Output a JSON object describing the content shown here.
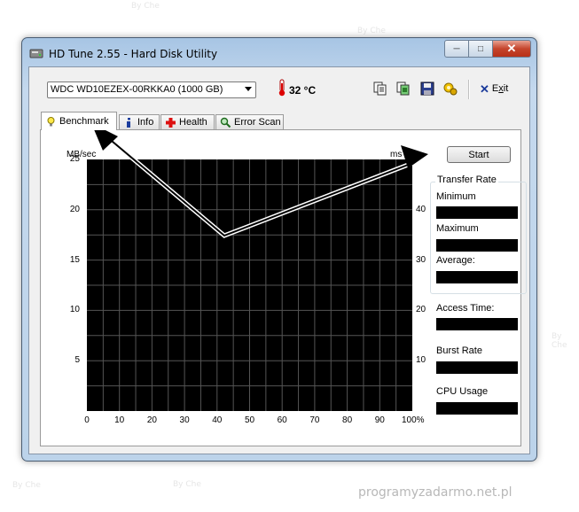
{
  "window": {
    "title": "HD Tune 2.55 - Hard Disk Utility",
    "caption": {
      "minimize": "─",
      "maximize": "□",
      "close": "✕"
    }
  },
  "toolbar": {
    "drive": "WDC WD10EZEX-00RKKA0 (1000 GB)",
    "temperature": "32 °C",
    "icons": [
      "copy-text-icon",
      "copy-screenshot-icon",
      "save-icon",
      "options-icon"
    ],
    "exit_prefix": "E",
    "exit_underlined": "x",
    "exit_suffix": "it"
  },
  "tabs": [
    {
      "label": "Benchmark",
      "icon": "lightbulb-icon",
      "active": true
    },
    {
      "label": "Info",
      "icon": "info-icon",
      "active": false
    },
    {
      "label": "Health",
      "icon": "health-cross-icon",
      "active": false
    },
    {
      "label": "Error Scan",
      "icon": "magnifier-icon",
      "active": false
    }
  ],
  "chart_data": {
    "type": "line",
    "left_unit": "MB/sec",
    "right_unit": "ms",
    "y_left_ticks": [
      "25",
      "20",
      "15",
      "10",
      "5"
    ],
    "y_right_ticks": [
      "40",
      "30",
      "20",
      "10"
    ],
    "x_ticks": [
      "0",
      "10",
      "20",
      "30",
      "40",
      "50",
      "60",
      "70",
      "80",
      "90",
      "100%"
    ],
    "ylim_left": [
      0,
      25
    ],
    "ylim_right": [
      0,
      50
    ],
    "xlim": [
      0,
      100
    ],
    "grid": true,
    "background": "#000000",
    "series": []
  },
  "panel": {
    "start_label": "Start",
    "transfer_rate_title": "Transfer Rate",
    "minimum_label": "Minimum",
    "maximum_label": "Maximum",
    "average_label": "Average:",
    "access_time_label": "Access Time:",
    "burst_rate_label": "Burst Rate",
    "cpu_usage_label": "CPU Usage"
  },
  "watermark": {
    "site": "programyzadarmo.net.pl",
    "corner_text": "By Che"
  },
  "colors": {
    "window_frame": "#bcd3ea",
    "close_button": "#c5452c",
    "chart_bg": "#000000",
    "grid": "#555555",
    "value_box": "#000000"
  }
}
